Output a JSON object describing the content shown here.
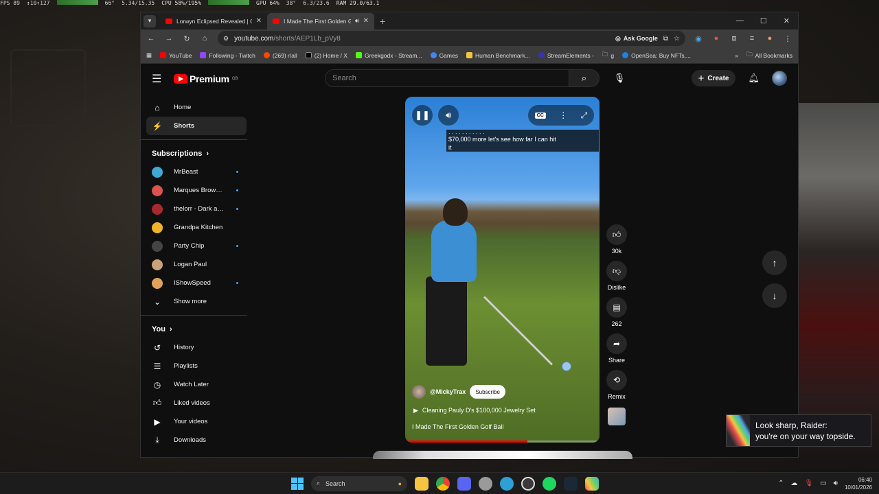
{
  "perf_overlay": {
    "fps": "FPS 89",
    "fps_extra": "↕10↑127",
    "cpu_temp": "66°",
    "cpu_mem": "5.34/15.35",
    "gpu": "GPU 64%",
    "gpu_temp": "38°",
    "vram": "6.3/23.6",
    "ram": "RAM 29.0/63.1",
    "cpu": "CPU 58%/195%"
  },
  "browser": {
    "tabs": [
      {
        "title": "Lorwyn Eclipsed Revealed | Gam",
        "active": false
      },
      {
        "title": "I Made The First Golden Go",
        "active": true
      }
    ],
    "url_domain": "youtube.com",
    "url_path": "/shorts/AEP1Lb_pVy8",
    "ask_google": "Ask Google",
    "bookmarks": [
      {
        "label": "YouTube",
        "color": "#ff0000"
      },
      {
        "label": "Following - Twitch",
        "color": "#9146ff"
      },
      {
        "label": "(269) r/all",
        "color": "#ff4500"
      },
      {
        "label": "(2) Home / X",
        "color": "#000000"
      },
      {
        "label": "Greekgodx - Stream...",
        "color": "#53fc18"
      },
      {
        "label": "Games",
        "color": "#4285f4"
      },
      {
        "label": "Human Benchmark...",
        "color": "#f5c542"
      },
      {
        "label": "StreamElements -",
        "color": "#3b30b5"
      },
      {
        "label": "g",
        "color": "#777777"
      },
      {
        "label": "OpenSea: Buy NFTs,...",
        "color": "#2081e2"
      }
    ],
    "all_bookmarks": "All Bookmarks"
  },
  "youtube": {
    "logo_text": "Premium",
    "logo_region": "GB",
    "search_placeholder": "Search",
    "create_label": "Create",
    "nav": [
      {
        "label": "Home",
        "icon": "home-icon",
        "active": false
      },
      {
        "label": "Shorts",
        "icon": "shorts-icon",
        "active": true
      }
    ],
    "subscriptions_title": "Subscriptions",
    "subscriptions": [
      {
        "name": "MrBeast",
        "live": true,
        "color": "#3fa9d6"
      },
      {
        "name": "Marques Brownl...",
        "live": true,
        "color": "#d9534f"
      },
      {
        "name": "thelorr - Dark an...",
        "live": true,
        "color": "#a8292f"
      },
      {
        "name": "Grandpa Kitchen",
        "live": false,
        "color": "#f0b429"
      },
      {
        "name": "Party Chip",
        "live": true,
        "color": "#444444"
      },
      {
        "name": "Logan Paul",
        "live": false,
        "color": "#c8a27a"
      },
      {
        "name": "IShowSpeed",
        "live": true,
        "color": "#e0a25a"
      }
    ],
    "show_more": "Show more",
    "you_title": "You",
    "you_items": [
      {
        "label": "History",
        "icon": "history-icon"
      },
      {
        "label": "Playlists",
        "icon": "playlists-icon"
      },
      {
        "label": "Watch Later",
        "icon": "watch-later-icon"
      },
      {
        "label": "Liked videos",
        "icon": "like-icon"
      },
      {
        "label": "Your videos",
        "icon": "your-videos-icon"
      },
      {
        "label": "Downloads",
        "icon": "download-icon"
      }
    ],
    "short": {
      "caption_line1": "$70,000 more let's see how far I can hit",
      "caption_line2": "it",
      "channel": "@MickyTrax",
      "subscribe": "Subscribe",
      "related": "Cleaning Pauly D's $100,000 Jewelry Set",
      "title": "I Made The First Golden Golf Ball",
      "progress": 0.63
    },
    "actions": {
      "likes": "30k",
      "dislike": "Dislike",
      "comments": "262",
      "share": "Share",
      "remix": "Remix"
    }
  },
  "toast": {
    "line1": "Look sharp, Raider:",
    "line2": "you're on your way topside."
  },
  "taskbar": {
    "search": "Search",
    "time": "06:40",
    "date": "10/01/2026"
  }
}
